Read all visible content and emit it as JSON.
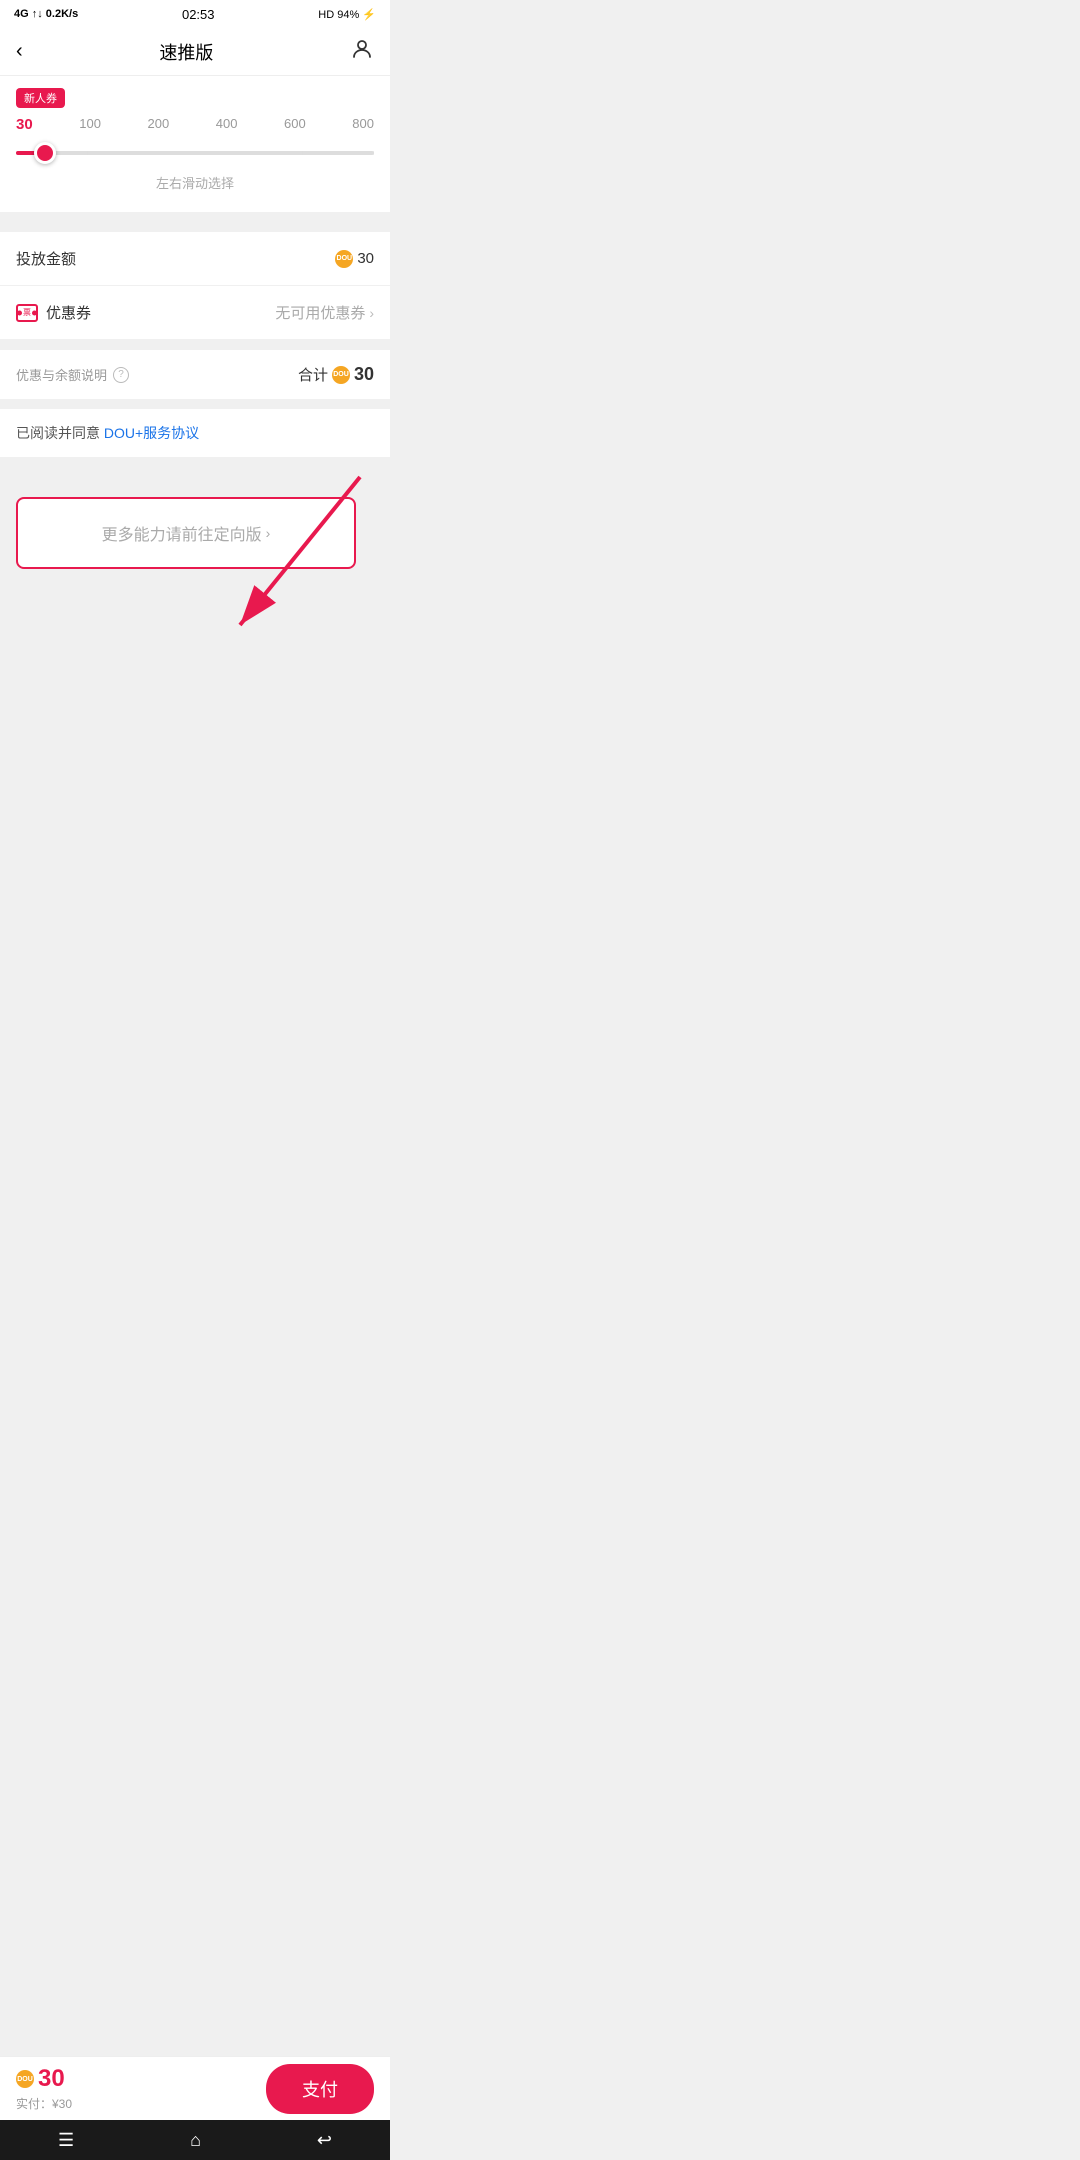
{
  "statusBar": {
    "left": "4G ↑↓ 0.2K/s",
    "center": "02:53",
    "right": "HD  94% ⚡"
  },
  "navBar": {
    "backIcon": "‹",
    "title": "速推版",
    "userIcon": "👤"
  },
  "sliderSection": {
    "tag": "新人券",
    "values": [
      "30",
      "100",
      "200",
      "400",
      "600",
      "800"
    ],
    "hint": "左右滑动选择"
  },
  "amountRow": {
    "label": "投放金额",
    "coinLabel": "DOU+",
    "value": "30"
  },
  "couponRow": {
    "label": "优惠券",
    "noAvailable": "无可用优惠券",
    "chevron": "›"
  },
  "summarySection": {
    "discountLabel": "优惠与余额说明",
    "helpIcon": "?",
    "totalLabel": "合计",
    "coinLabel": "DOU+",
    "totalValue": "30"
  },
  "agreementSection": {
    "prefix": "已阅读并同意 ",
    "link": "DOU+服务协议"
  },
  "redirectButton": {
    "label": "更多能力请前往定向版",
    "chevron": "›"
  },
  "bottomBar": {
    "coinLabel": "DOU+",
    "amount": "30",
    "actualLabel": "实付：¥30",
    "payButton": "支付"
  },
  "systemNav": {
    "menu": "☰",
    "home": "⌂",
    "back": "↩"
  }
}
